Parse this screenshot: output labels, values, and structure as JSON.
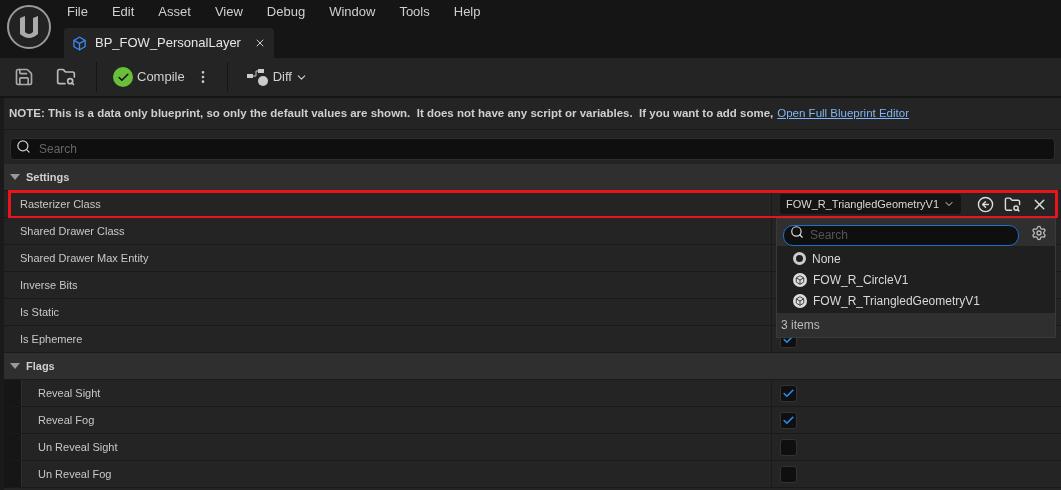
{
  "menu": [
    "File",
    "Edit",
    "Asset",
    "View",
    "Debug",
    "Window",
    "Tools",
    "Help"
  ],
  "tab": {
    "title": "BP_FOW_PersonalLayer"
  },
  "toolbar": {
    "compile": "Compile",
    "diff": "Diff"
  },
  "note": {
    "text": "NOTE: This is a data only blueprint, so only the default values are shown.  It does not have any script or variables.  If you want to add some,",
    "link": "Open Full Blueprint Editor"
  },
  "search": {
    "placeholder": "Search"
  },
  "groups": [
    {
      "title": "Settings",
      "expanded": true,
      "children": [
        {
          "label": "Rasterizer Class",
          "kind": "class_picker",
          "value": "FOW_R_TriangledGeometryV1",
          "highlighted": true
        },
        {
          "label": "Shared Drawer Class",
          "kind": "hidden",
          "highlighted": false
        },
        {
          "label": "Shared Drawer Max Entity",
          "kind": "hidden",
          "highlighted": false
        },
        {
          "label": "Inverse Bits",
          "kind": "hidden",
          "highlighted": false
        },
        {
          "label": "Is Static",
          "kind": "hidden",
          "highlighted": false
        },
        {
          "label": "Is Ephemere",
          "kind": "checkbox",
          "checked": true,
          "highlighted": false
        }
      ]
    },
    {
      "title": "Flags",
      "expanded": true,
      "children": [
        {
          "label": "Reveal Sight",
          "kind": "checkbox",
          "checked": true,
          "highlighted": false
        },
        {
          "label": "Reveal Fog",
          "kind": "checkbox",
          "checked": true,
          "highlighted": false
        },
        {
          "label": "Un Reveal Sight",
          "kind": "checkbox",
          "checked": false,
          "highlighted": false
        },
        {
          "label": "Un Reveal Fog",
          "kind": "checkbox",
          "checked": false,
          "highlighted": false
        }
      ]
    }
  ],
  "popup": {
    "placeholder": "Search",
    "items": [
      {
        "label": "None",
        "kind": "none"
      },
      {
        "label": "FOW_R_CircleV1",
        "kind": "class"
      },
      {
        "label": "FOW_R_TriangledGeometryV1",
        "kind": "class"
      }
    ],
    "count": "3 items"
  }
}
